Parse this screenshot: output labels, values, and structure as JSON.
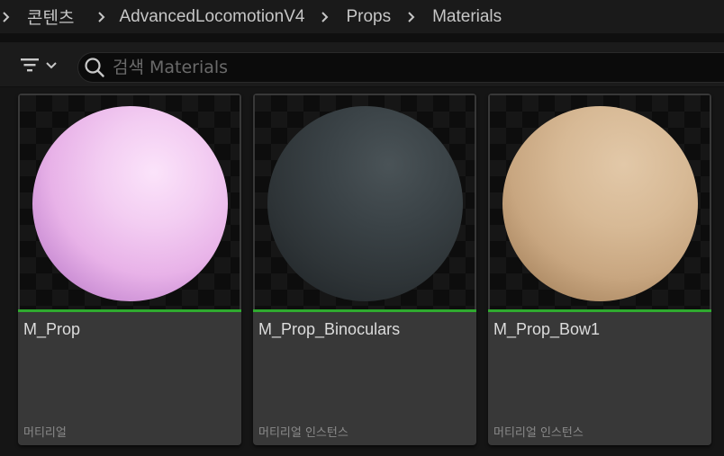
{
  "breadcrumb": {
    "items": [
      "콘텐츠",
      "AdvancedLocomotionV4",
      "Props",
      "Materials"
    ]
  },
  "toolbar": {
    "filter_icon": "filter-icon",
    "dropdown_icon": "chevron-down-icon"
  },
  "search": {
    "placeholder": "검색 Materials",
    "value": "",
    "icon": "search-icon"
  },
  "assets": [
    {
      "name": "M_Prop",
      "type": "머티리얼",
      "preview_color": "#f0c4ef"
    },
    {
      "name": "M_Prop_Binoculars",
      "type": "머티리얼 인스턴스",
      "preview_color": "#30363a"
    },
    {
      "name": "M_Prop_Bow1",
      "type": "머티리얼 인스턴스",
      "preview_color": "#d2b592"
    }
  ],
  "colors": {
    "accent": "#2faa2f",
    "tile_background": "#383838",
    "app_background": "#151515"
  }
}
